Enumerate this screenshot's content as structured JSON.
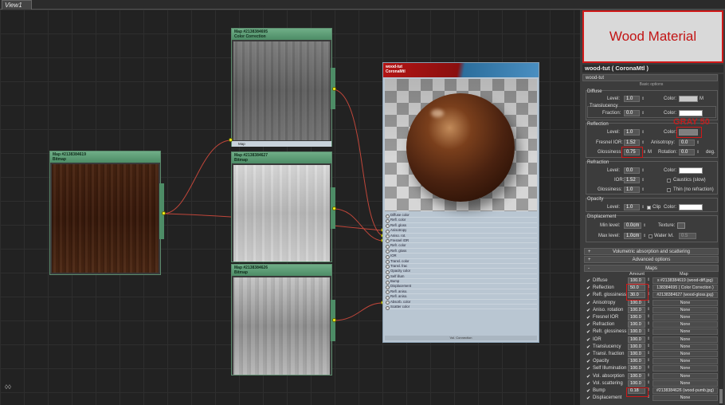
{
  "tabs": {
    "view": "View1"
  },
  "nodes": {
    "color_correction": {
      "title": "Map #2138384695",
      "subtitle": "Color Correction",
      "port": "Map"
    },
    "bitmap_gloss": {
      "title": "Map #2138384627",
      "subtitle": "Bitmap"
    },
    "bitmap_bump": {
      "title": "Map #2138384626",
      "subtitle": "Bitmap"
    },
    "bitmap_diffuse": {
      "title": "Map #2138384619",
      "subtitle": "Bitmap"
    },
    "material": {
      "title": "wood-tut",
      "subtitle": "CoronaMtl",
      "ports": [
        "Diffuse color",
        "Refl. color",
        "Refl. gloss",
        "Anisotropy",
        "Aniso. rot.",
        "Fresnel IOR",
        "Refr. color",
        "Refr. gloss",
        "IOR",
        "Transl. color",
        "Transl. frac",
        "Opacity color",
        "Self illum",
        "Bump",
        "Displacement",
        "Refl. aniso.",
        "Refl. aniso.",
        "Absorb. color",
        "Scatter color"
      ],
      "footer": "Vol. Connection"
    }
  },
  "panel": {
    "heading": "Wood Material",
    "material_name": "wood-tut  ( CoronaMtl )",
    "material_sub": "wood-tut",
    "basic_options": "Basic options",
    "diffuse": {
      "title": "Diffuse",
      "level_label": "Level:",
      "level": "1.0",
      "color_label": "Color:",
      "m": "M",
      "translucency_title": "Translucency",
      "fraction_label": "Fraction:",
      "fraction": "0.0",
      "color2_label": "Color:"
    },
    "reflection": {
      "title": "Reflection",
      "annotation": "GRAY 50",
      "level_label": "Level:",
      "level": "1.0",
      "color_label": "Color:",
      "fresnel_label": "Fresnel IOR:",
      "fresnel": "1.52",
      "aniso_label": "Anisotropy:",
      "aniso": "0.0",
      "gloss_label": "Glossiness:",
      "gloss": "0.75",
      "m": "M",
      "rotation_label": "Rotation:",
      "rotation": "0.0",
      "deg": "deg."
    },
    "refraction": {
      "title": "Refraction",
      "level_label": "Level:",
      "level": "0.0",
      "color_label": "Color:",
      "ior_label": "IOR:",
      "ior": "1.52",
      "caustics_label": "Caustics (slow)",
      "gloss_label": "Glossiness:",
      "gloss": "1.0",
      "thin_label": "Thin (no refraction)"
    },
    "opacity": {
      "title": "Opacity",
      "level_label": "Level:",
      "level": "1.0",
      "clip_label": "Clip",
      "color_label": "Color:"
    },
    "displacement": {
      "title": "Displacement",
      "min_label": "Min level:",
      "min": "0.0cm",
      "texture_label": "Texture:",
      "max_label": "Max level:",
      "max": "1.0cm",
      "water_label": "Water lvl.",
      "water": "0.5"
    },
    "rollouts": {
      "volumetric": "Volumetric absorption and scattering",
      "advanced": "Advanced options",
      "maps": "Maps",
      "plus": "+",
      "minus": "-"
    },
    "maps_header": {
      "amount": "Amount",
      "map": "Map"
    },
    "maps": [
      {
        "label": "Diffuse",
        "amount": "100.0",
        "map": "s #2138384619 (wood-diff.jpg)"
      },
      {
        "label": "Reflection",
        "amount": "50.0",
        "map": "138384695  ( Color Correction )"
      },
      {
        "label": "Refl. glossiness",
        "amount": "30.0",
        "map": "#2138384627 (wood-gloss.jpg)"
      },
      {
        "label": "Anisotropy",
        "amount": "100.0",
        "map": "None"
      },
      {
        "label": "Aniso. rotation",
        "amount": "100.0",
        "map": "None"
      },
      {
        "label": "Fresnel IOR",
        "amount": "100.0",
        "map": "None"
      },
      {
        "label": "Refraction",
        "amount": "100.0",
        "map": "None"
      },
      {
        "label": "Refr. glossiness",
        "amount": "100.0",
        "map": "None"
      },
      {
        "label": "IOR",
        "amount": "100.0",
        "map": "None"
      },
      {
        "label": "Translucency",
        "amount": "100.0",
        "map": "None"
      },
      {
        "label": "Transl. fraction",
        "amount": "100.0",
        "map": "None"
      },
      {
        "label": "Opacity",
        "amount": "100.0",
        "map": "None"
      },
      {
        "label": "Self Illumination",
        "amount": "100.0",
        "map": "None"
      },
      {
        "label": "Vol. absorption",
        "amount": "100.0",
        "map": "None"
      },
      {
        "label": "Vol. scattering",
        "amount": "100.0",
        "map": "None"
      },
      {
        "label": "Bump",
        "amount": "0.18",
        "map": "#2138384626 (wood-pumb.jpg)"
      },
      {
        "label": "Displacement",
        "amount": "",
        "map": "None"
      }
    ],
    "colors": {
      "accent_red": "#d01919",
      "node_green": "#4d8c66"
    }
  }
}
